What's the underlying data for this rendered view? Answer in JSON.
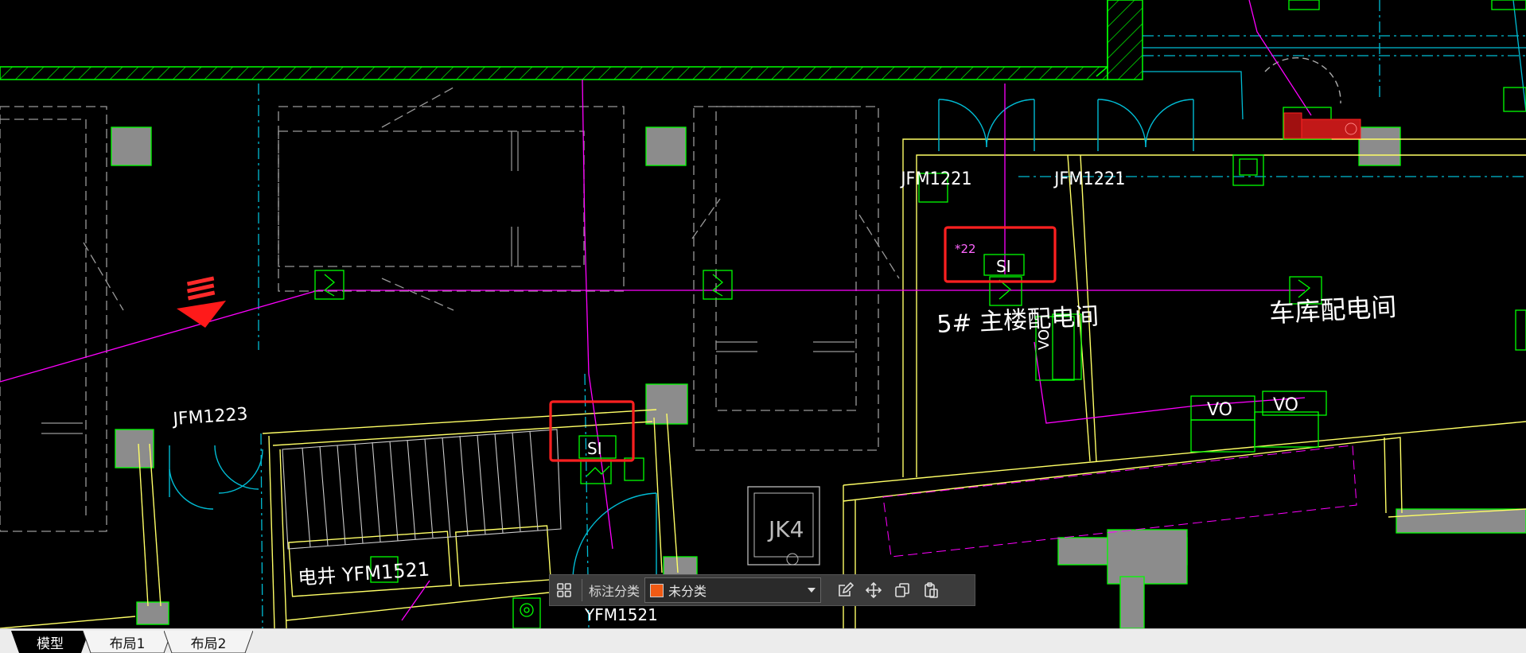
{
  "colors": {
    "background": "#000000",
    "wall": "#00ff00",
    "axis": "#00bcd4",
    "boundary": "#ffff66",
    "cable": "#ff00ff",
    "highlight": "#ff2020",
    "text": "#ffffff",
    "swatch": "#f05a14"
  },
  "drawing": {
    "labels": {
      "door_jfm1221_a": "JFM1221",
      "door_jfm1221_b": "JFM1221",
      "door_jfm1223": "JFM1223",
      "door_yfm1521": "电井  YFM1521",
      "door_yfm1521_lower": "YFM1521",
      "room_main_power": "5# 主楼配电间",
      "room_garage_power": "车库配电间",
      "elevator_jk4": "JK4",
      "symbol_si_1": "SI",
      "symbol_si_2": "SI",
      "mark_22": "*22",
      "vo_1": "VO",
      "vo_2": "VO",
      "vo_vertical": "VO"
    },
    "highlight_boxes": [
      "annotation-box-1",
      "annotation-box-2"
    ],
    "arrow_icon": "red-down-arrow-icon"
  },
  "toolbar": {
    "grid_icon": "grid-icon",
    "label": "标注分类",
    "category_value": "未分类",
    "category_swatch": "#f05a14",
    "edit_icon": "edit-icon",
    "move_icon": "move-icon",
    "copy_icon": "copy-icon",
    "paste_icon": "paste-icon"
  },
  "tabs": [
    {
      "label": "模型",
      "active": true
    },
    {
      "label": "布局1",
      "active": false
    },
    {
      "label": "布局2",
      "active": false
    }
  ]
}
